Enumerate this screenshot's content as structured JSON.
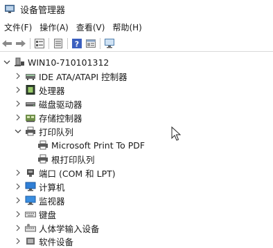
{
  "window": {
    "title": "设备管理器"
  },
  "menu": [
    "文件(F)",
    "操作(A)",
    "查看(V)",
    "帮助(H)"
  ],
  "toolbar": [
    "back-icon",
    "forward-icon",
    "properties-icon",
    "device-list-icon",
    "help-icon",
    "view-icon",
    "monitor-icon"
  ],
  "tree": {
    "root": "WIN10-710101312",
    "items": [
      {
        "label": "IDE ATA/ATAPI 控制器",
        "icon": "ide-controller-icon",
        "expanded": false
      },
      {
        "label": "处理器",
        "icon": "processor-icon",
        "expanded": false
      },
      {
        "label": "磁盘驱动器",
        "icon": "disk-drive-icon",
        "expanded": false
      },
      {
        "label": "存储控制器",
        "icon": "storage-controller-icon",
        "expanded": false
      },
      {
        "label": "打印队列",
        "icon": "printer-icon",
        "expanded": true
      },
      {
        "label": "Microsoft Print To PDF",
        "icon": "printer-icon",
        "child": true
      },
      {
        "label": "根打印队列",
        "icon": "printer-icon",
        "child": true
      },
      {
        "label": "端口 (COM 和 LPT)",
        "icon": "port-icon",
        "expanded": false
      },
      {
        "label": "计算机",
        "icon": "computer-icon",
        "expanded": false
      },
      {
        "label": "监视器",
        "icon": "monitor-icon",
        "expanded": false
      },
      {
        "label": "键盘",
        "icon": "keyboard-icon",
        "expanded": false
      },
      {
        "label": "人体学输入设备",
        "icon": "hid-icon",
        "expanded": false
      },
      {
        "label": "软件设备",
        "icon": "software-device-icon",
        "expanded": false
      }
    ]
  }
}
